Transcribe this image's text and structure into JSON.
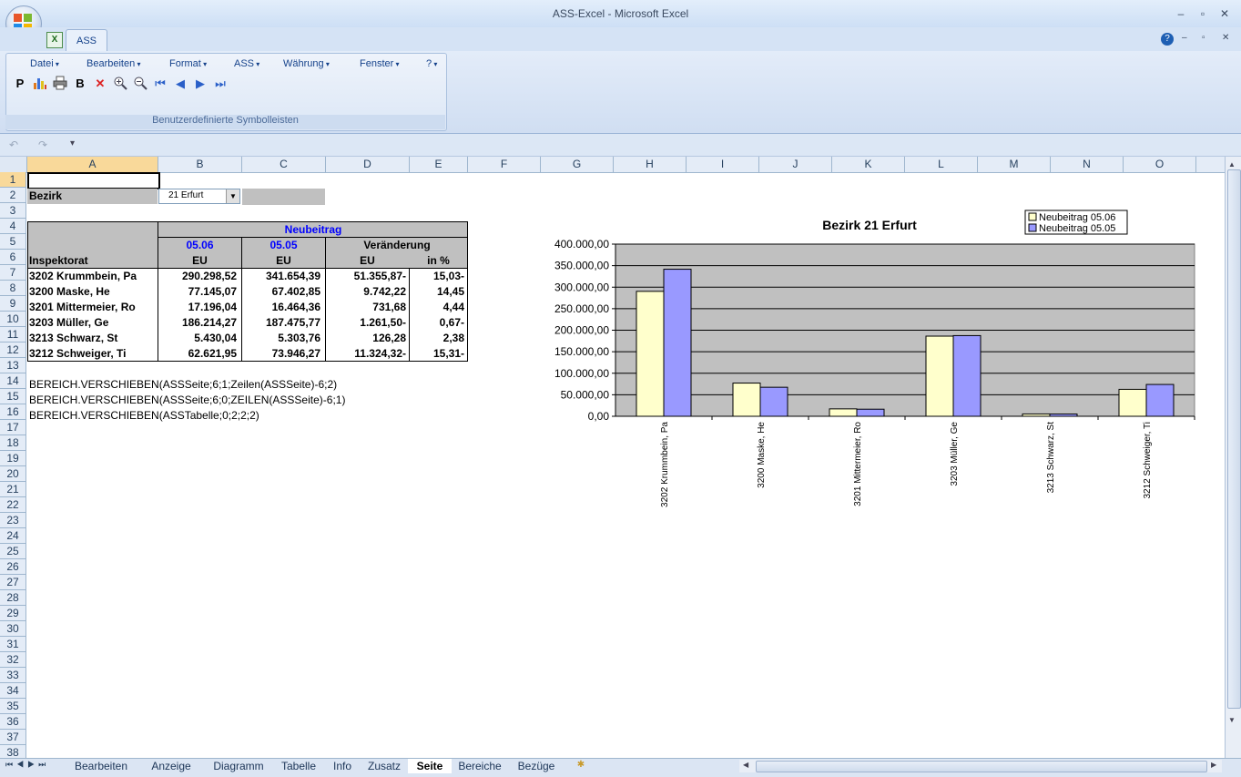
{
  "window": {
    "title": "ASS-Excel - Microsoft Excel",
    "tab": "ASS",
    "min": "‒",
    "max": "▫",
    "close": "✕"
  },
  "ribbon": {
    "menus": [
      "Datei",
      "Bearbeiten",
      "Format",
      "ASS",
      "Währung",
      "Fenster",
      "?"
    ],
    "group_label": "Benutzerdefinierte Symbolleisten",
    "tool_p": "P",
    "tool_b": "B"
  },
  "columns": [
    "A",
    "B",
    "C",
    "D",
    "E",
    "F",
    "G",
    "H",
    "I",
    "J",
    "K",
    "L",
    "M",
    "N",
    "O"
  ],
  "rows": [
    "1",
    "2",
    "3",
    "4",
    "5",
    "6",
    "7",
    "8",
    "9",
    "10",
    "11",
    "12",
    "13",
    "14",
    "15",
    "16",
    "17",
    "18",
    "19",
    "20",
    "21",
    "22",
    "23",
    "24",
    "25",
    "26",
    "27",
    "28",
    "29",
    "30",
    "31",
    "32",
    "33",
    "34",
    "35",
    "36",
    "37",
    "38"
  ],
  "sheet": {
    "bezirk_label": "Bezirk",
    "bezirk_value": "21 Erfurt",
    "header_neubeitrag": "Neubeitrag",
    "header_0506": "05.06",
    "header_0505": "05.05",
    "header_veraenderung": "Veränderung",
    "header_inspektorat": "Inspektorat",
    "header_eu1": "EU",
    "header_eu2": "EU",
    "header_eu3": "EU",
    "header_inpct": "in %",
    "data": [
      {
        "name": "3202 Krummbein, Pa",
        "v06": "290.298,52",
        "v05": "341.654,39",
        "diff": "51.355,87-",
        "pct": "15,03-"
      },
      {
        "name": "3200 Maske, He",
        "v06": "77.145,07",
        "v05": "67.402,85",
        "diff": "9.742,22",
        "pct": "14,45"
      },
      {
        "name": "3201 Mittermeier, Ro",
        "v06": "17.196,04",
        "v05": "16.464,36",
        "diff": "731,68",
        "pct": "4,44"
      },
      {
        "name": "3203 Müller, Ge",
        "v06": "186.214,27",
        "v05": "187.475,77",
        "diff": "1.261,50-",
        "pct": "0,67-"
      },
      {
        "name": "3213 Schwarz, St",
        "v06": "5.430,04",
        "v05": "5.303,76",
        "diff": "126,28",
        "pct": "2,38"
      },
      {
        "name": "3212 Schweiger, Ti",
        "v06": "62.621,95",
        "v05": "73.946,27",
        "diff": "11.324,32-",
        "pct": "15,31-"
      }
    ],
    "formulas": [
      "BEREICH.VERSCHIEBEN(ASSSeite;6;1;Zeilen(ASSSeite)-6;2)",
      "BEREICH.VERSCHIEBEN(ASSSeite;6;0;ZEILEN(ASSSeite)-6;1)",
      "BEREICH.VERSCHIEBEN(ASSTabelle;0;2;2;2)"
    ]
  },
  "chart_data": {
    "type": "bar",
    "title": "Bezirk 21 Erfurt",
    "categories": [
      "3202 Krummbein, Pa",
      "3200 Maske, He",
      "3201 Mittermeier, Ro",
      "3203 Müller, Ge",
      "3213 Schwarz, St",
      "3212 Schweiger, Ti"
    ],
    "series": [
      {
        "name": "Neubeitrag 05.06",
        "values": [
          290298.52,
          77145.07,
          17196.04,
          186214.27,
          5430.04,
          62621.95
        ],
        "color": "#ffffcc"
      },
      {
        "name": "Neubeitrag 05.05",
        "values": [
          341654.39,
          67402.85,
          16464.36,
          187475.77,
          5303.76,
          73946.27
        ],
        "color": "#9999ff"
      }
    ],
    "yticks": [
      "0,00",
      "50.000,00",
      "100.000,00",
      "150.000,00",
      "200.000,00",
      "250.000,00",
      "300.000,00",
      "350.000,00",
      "400.000,00"
    ],
    "ylim": [
      0,
      400000
    ],
    "grid": true,
    "plot_background": "#c0c0c0",
    "legend": "top-right"
  },
  "sheet_tabs": [
    "Bearbeiten",
    "Anzeige",
    "Diagramm",
    "Tabelle",
    "Info",
    "Zusatz",
    "Seite",
    "Bereiche",
    "Bezüge"
  ],
  "active_sheet": "Seite"
}
